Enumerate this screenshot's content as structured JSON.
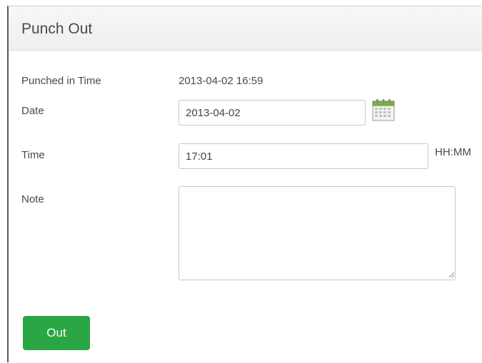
{
  "panel": {
    "title": "Punch Out"
  },
  "form": {
    "punched_in_label": "Punched in Time",
    "punched_in_value": "2013-04-02 16:59",
    "date_label": "Date",
    "date_value": "2013-04-02",
    "time_label": "Time",
    "time_value": "17:01",
    "time_format_hint": "HH:MM",
    "note_label": "Note",
    "note_value": ""
  },
  "actions": {
    "out_label": "Out"
  },
  "colors": {
    "button_green": "#2aa744",
    "calendar_green": "#7cb342"
  },
  "icons": {
    "calendar": "calendar-icon",
    "resize": "resize-grip-icon"
  }
}
